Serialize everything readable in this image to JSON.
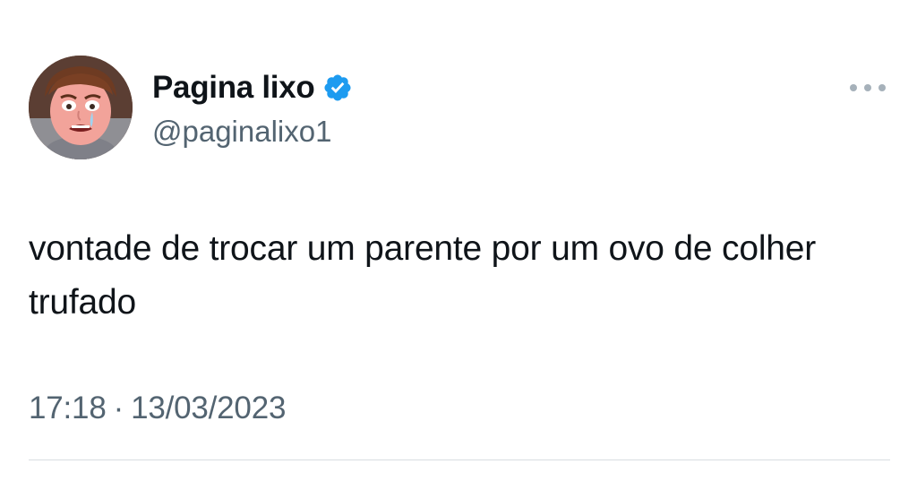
{
  "author": {
    "display_name": "Pagina lixo",
    "handle": "@paginalixo1",
    "verified": true,
    "avatar_icon": "crying-cartoon-face-avatar"
  },
  "tweet": {
    "text": "vontade de trocar um parente por um ovo de colher trufado"
  },
  "meta": {
    "time": "17:18",
    "separator": "·",
    "date": "13/03/2023"
  },
  "icons": {
    "verified": "verified-badge-icon",
    "more": "more-options-icon"
  },
  "colors": {
    "verified_blue": "#1d9bf0",
    "text_primary": "#0f1419",
    "text_secondary": "#536471",
    "divider": "#d8dde1"
  }
}
